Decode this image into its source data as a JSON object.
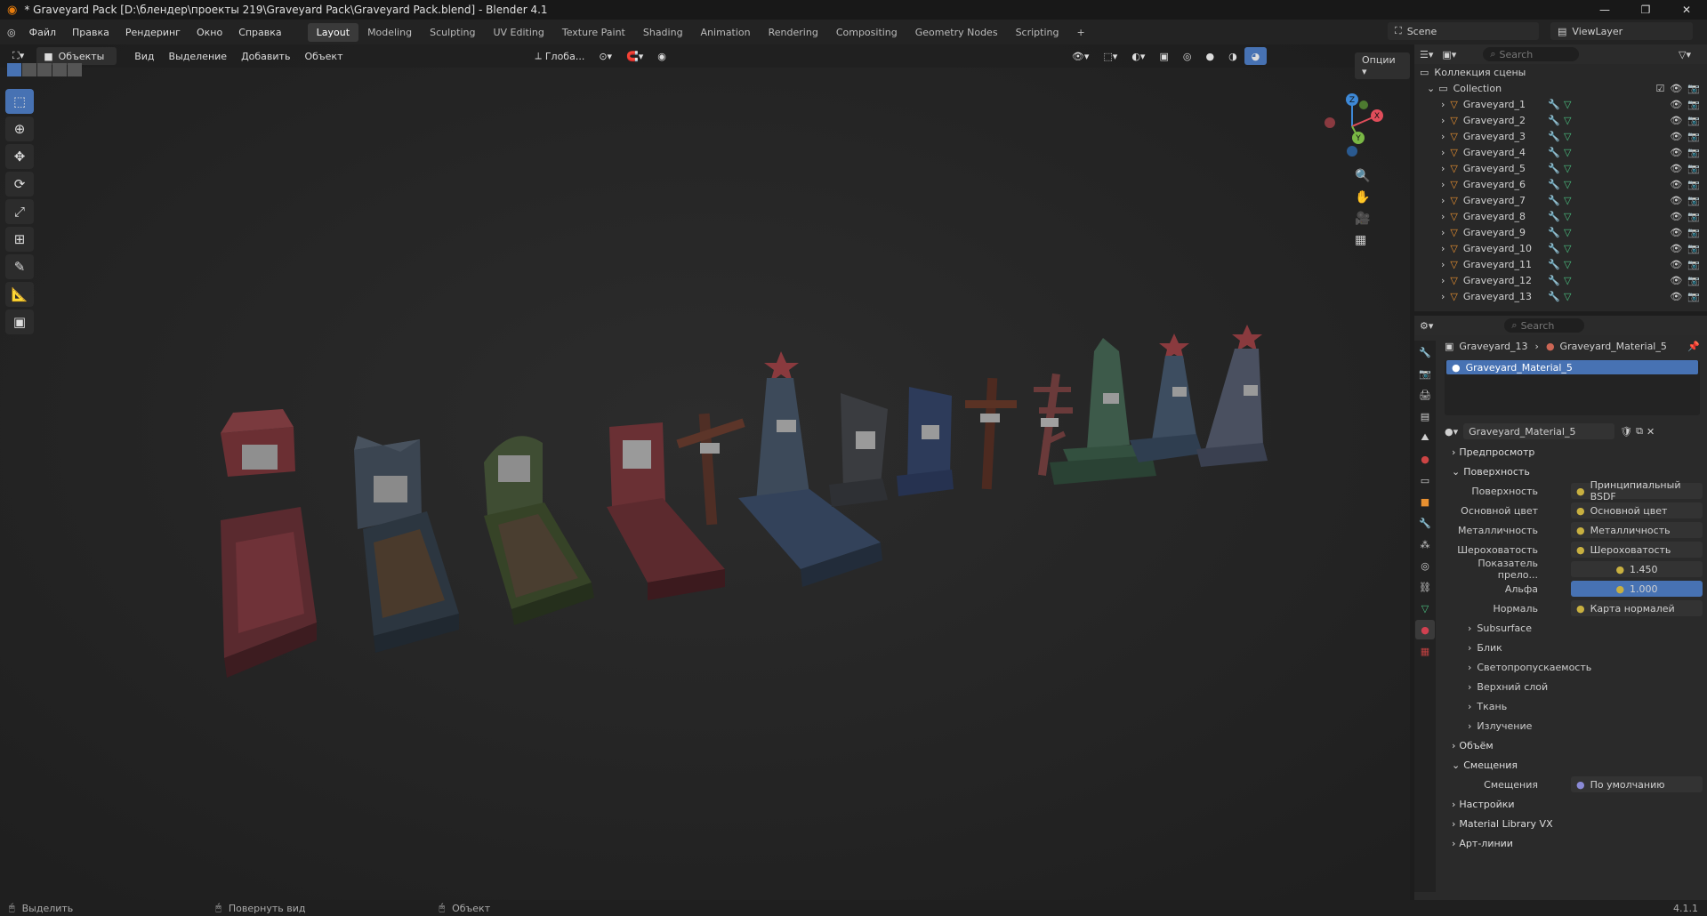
{
  "window": {
    "title": "* Graveyard Pack [D:\\блендер\\проекты 219\\Graveyard Pack\\Graveyard Pack.blend] - Blender 4.1",
    "controls": [
      "—",
      "❐",
      "✕"
    ]
  },
  "menu": [
    "Файл",
    "Правка",
    "Рендеринг",
    "Окно",
    "Справка"
  ],
  "workspaces": [
    "Layout",
    "Modeling",
    "Sculpting",
    "UV Editing",
    "Texture Paint",
    "Shading",
    "Animation",
    "Rendering",
    "Compositing",
    "Geometry Nodes",
    "Scripting"
  ],
  "workspace_add": "+",
  "scene": {
    "label": "Scene"
  },
  "view_layer": {
    "label": "ViewLayer"
  },
  "viewport_header": {
    "mode": "Объекты",
    "menus": [
      "Вид",
      "Выделение",
      "Добавить",
      "Объект"
    ],
    "transform": "Глоба...",
    "options": "Опции"
  },
  "outliner": {
    "search_placeholder": "Search",
    "root": "Коллекция сцены",
    "collection": "Collection",
    "items": [
      "Graveyard_1",
      "Graveyard_2",
      "Graveyard_3",
      "Graveyard_4",
      "Graveyard_5",
      "Graveyard_6",
      "Graveyard_7",
      "Graveyard_8",
      "Graveyard_9",
      "Graveyard_10",
      "Graveyard_11",
      "Graveyard_12",
      "Graveyard_13"
    ]
  },
  "properties": {
    "search_placeholder": "Search",
    "breadcrumb_object": "Graveyard_13",
    "breadcrumb_material": "Graveyard_Material_5",
    "slot": "Graveyard_Material_5",
    "material_name": "Graveyard_Material_5",
    "panels": {
      "preview": "Предпросмотр",
      "surface": "Поверхность",
      "volume": "Объём",
      "displacement": "Смещения",
      "settings": "Настройки",
      "material_library": "Material Library VX",
      "line_art": "Арт-линии"
    },
    "surface_rows": [
      {
        "label": "Поверхность",
        "value": "Принципиальный BSDF"
      },
      {
        "label": "Основной цвет",
        "value": "Основной цвет"
      },
      {
        "label": "Металличность",
        "value": "Металличность"
      },
      {
        "label": "Шероховатость",
        "value": "Шероховатость"
      },
      {
        "label": "Показатель прело...",
        "value": "1.450"
      },
      {
        "label": "Альфа",
        "value": "1.000"
      },
      {
        "label": "Нормаль",
        "value": "Карта нормалей"
      }
    ],
    "subpanels": [
      "Subsurface",
      "Блик",
      "Светопропускаемость",
      "Верхний слой",
      "Ткань",
      "Излучение"
    ],
    "displacement_row": {
      "label": "Смещения",
      "value": "По умолчанию"
    }
  },
  "status": {
    "select": "Выделить",
    "rotate": "Повернуть вид",
    "object": "Объект",
    "version": "4.1.1"
  },
  "gizmo": {
    "z": "Z",
    "y": "Y",
    "x": "X"
  },
  "colors": {
    "accent": "#4772b3",
    "x_axis": "#e04d5a",
    "y_axis": "#7ab845",
    "z_axis": "#3d88d6"
  }
}
